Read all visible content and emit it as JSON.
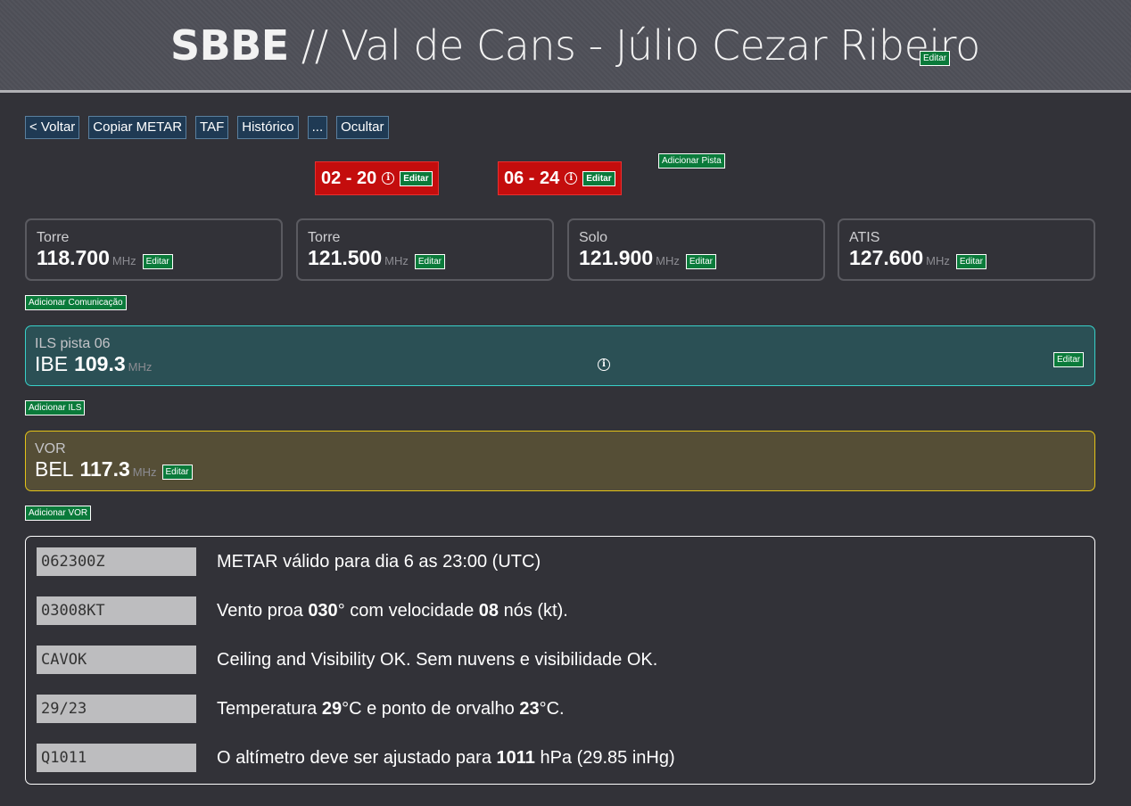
{
  "header": {
    "icao": "SBBE",
    "separator": " // ",
    "name": "Val de Cans - Júlio Cezar Ribeiro",
    "edit_label": "Editar"
  },
  "toolbar": {
    "back": "< Voltar",
    "copy_metar": "Copiar METAR",
    "taf": "TAF",
    "history": "Histórico",
    "more": "...",
    "hide": "Ocultar"
  },
  "runways": [
    {
      "name": "02 - 20",
      "edit_label": "Editar",
      "color": "#c40d0d"
    },
    {
      "name": "06 - 24",
      "edit_label": "Editar",
      "color": "#c40d0d"
    }
  ],
  "add_runway": "Adicionar Pista",
  "communications": [
    {
      "name": "Torre",
      "freq": "118.700",
      "unit": "MHz",
      "edit_label": "Editar"
    },
    {
      "name": "Torre",
      "freq": "121.500",
      "unit": "MHz",
      "edit_label": "Editar"
    },
    {
      "name": "Solo",
      "freq": "121.900",
      "unit": "MHz",
      "edit_label": "Editar"
    },
    {
      "name": "ATIS",
      "freq": "127.600",
      "unit": "MHz",
      "edit_label": "Editar"
    }
  ],
  "add_communication": "Adicionar Comunicação",
  "ils": {
    "name": "ILS pista 06",
    "ident": "IBE",
    "freq": "109.3",
    "unit": "MHz",
    "edit_label": "Editar",
    "color": "#38d0c8"
  },
  "add_ils": "Adicionar ILS",
  "vor": {
    "name": "VOR",
    "ident": "BEL",
    "freq": "117.3",
    "unit": "MHz",
    "edit_label": "Editar",
    "color": "#e3c318"
  },
  "add_vor": "Adicionar VOR",
  "metar": [
    {
      "code": "062300Z",
      "parts": [
        "METAR válido para dia 6 as 23:00 (UTC)"
      ]
    },
    {
      "code": "03008KT",
      "parts": [
        "Vento proa ",
        "030",
        "° com velocidade ",
        "08",
        " nós (kt)."
      ]
    },
    {
      "code": "CAVOK",
      "parts": [
        "Ceiling and Visibility OK. Sem nuvens e visibilidade OK."
      ]
    },
    {
      "code": "29/23",
      "parts": [
        "Temperatura ",
        "29",
        "°C e ponto de orvalho ",
        "23",
        "°C."
      ]
    },
    {
      "code": "Q1011",
      "parts": [
        "O altímetro deve ser ajustado para ",
        "1011",
        " hPa (29.85 inHg)"
      ]
    }
  ]
}
